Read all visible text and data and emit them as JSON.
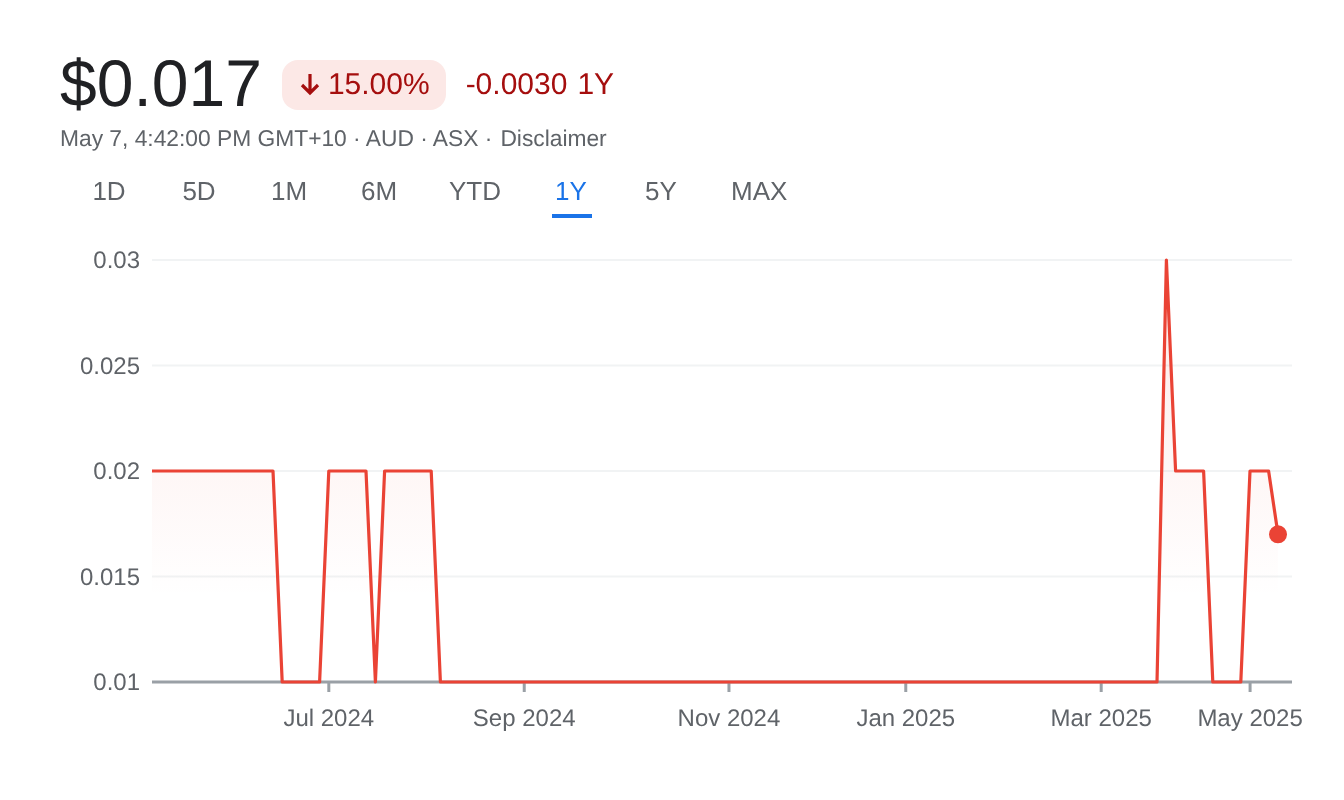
{
  "quote": {
    "price": "$0.017",
    "change_percent": "15.00%",
    "negative": true,
    "change": "-0.0030",
    "period": "1Y",
    "meta": "May 7, 4:42:00 PM GMT+10 · AUD · ASX ·",
    "disclaimer": "Disclaimer"
  },
  "ranges": [
    {
      "label": "1D",
      "selected": false
    },
    {
      "label": "5D",
      "selected": false
    },
    {
      "label": "1M",
      "selected": false
    },
    {
      "label": "6M",
      "selected": false
    },
    {
      "label": "YTD",
      "selected": false
    },
    {
      "label": "1Y",
      "selected": true
    },
    {
      "label": "5Y",
      "selected": false
    },
    {
      "label": "MAX",
      "selected": false
    }
  ],
  "chart": {
    "chart_data": {
      "type": "area",
      "categories": [
        null,
        null,
        null,
        null,
        null,
        null,
        null,
        null,
        null,
        null,
        null,
        null,
        null,
        null,
        null,
        null,
        null,
        null,
        null,
        "Jul 2024",
        null,
        null,
        null,
        null,
        null,
        null,
        null,
        null,
        null,
        null,
        null,
        null,
        null,
        null,
        null,
        null,
        null,
        null,
        null,
        null,
        "Sep 2024",
        null,
        null,
        null,
        null,
        null,
        null,
        null,
        null,
        null,
        null,
        null,
        null,
        null,
        null,
        null,
        null,
        null,
        null,
        null,
        null,
        null,
        "Nov 2024",
        null,
        null,
        null,
        null,
        null,
        null,
        null,
        null,
        null,
        null,
        null,
        null,
        null,
        null,
        null,
        null,
        null,
        null,
        "Jan 2025",
        null,
        null,
        null,
        null,
        null,
        null,
        null,
        null,
        null,
        null,
        null,
        null,
        null,
        null,
        null,
        null,
        null,
        null,
        null,
        null,
        "Mar 2025",
        null,
        null,
        null,
        null,
        null,
        null,
        null,
        null,
        null,
        null,
        null,
        null,
        null,
        null,
        null,
        "May 2025",
        null,
        null,
        null
      ],
      "series": [
        {
          "color": "#ea4335",
          "values": [
            0.02,
            0.02,
            0.02,
            0.02,
            0.02,
            0.02,
            0.02,
            0.02,
            0.02,
            0.02,
            0.02,
            0.02,
            0.02,
            0.02,
            0.01,
            0.01,
            0.01,
            0.01,
            0.01,
            0.02,
            0.02,
            0.02,
            0.02,
            0.02,
            0.01,
            0.02,
            0.02,
            0.02,
            0.02,
            0.02,
            0.02,
            0.01,
            0.01,
            0.01,
            0.01,
            0.01,
            0.01,
            0.01,
            0.01,
            0.01,
            0.01,
            0.01,
            0.01,
            0.01,
            0.01,
            0.01,
            0.01,
            0.01,
            0.01,
            0.01,
            0.01,
            0.01,
            0.01,
            0.01,
            0.01,
            0.01,
            0.01,
            0.01,
            0.01,
            0.01,
            0.01,
            0.01,
            0.01,
            0.01,
            0.01,
            0.01,
            0.01,
            0.01,
            0.01,
            0.01,
            0.01,
            0.01,
            0.01,
            0.01,
            0.01,
            0.01,
            0.01,
            0.01,
            0.01,
            0.01,
            0.01,
            0.01,
            0.01,
            0.01,
            0.01,
            0.01,
            0.01,
            0.01,
            0.01,
            0.01,
            0.01,
            0.01,
            0.01,
            0.01,
            0.01,
            0.01,
            0.01,
            0.01,
            0.01,
            0.01,
            0.01,
            0.01,
            0.01,
            0.01,
            0.01,
            0.01,
            0.01,
            0.01,
            0.01,
            0.03,
            0.02,
            0.02,
            0.02,
            0.02,
            0.01,
            0.01,
            0.01,
            0.01,
            0.02,
            0.02,
            0.02,
            0.017
          ]
        }
      ],
      "grid": true,
      "ylim": [
        0.01,
        0.03
      ],
      "yticks": [
        {
          "value": 0.01,
          "label": "0.01"
        },
        {
          "value": 0.015,
          "label": "0.015"
        },
        {
          "value": 0.02,
          "label": "0.02"
        },
        {
          "value": 0.025,
          "label": "0.025"
        },
        {
          "value": 0.03,
          "label": "0.03"
        }
      ]
    }
  }
}
